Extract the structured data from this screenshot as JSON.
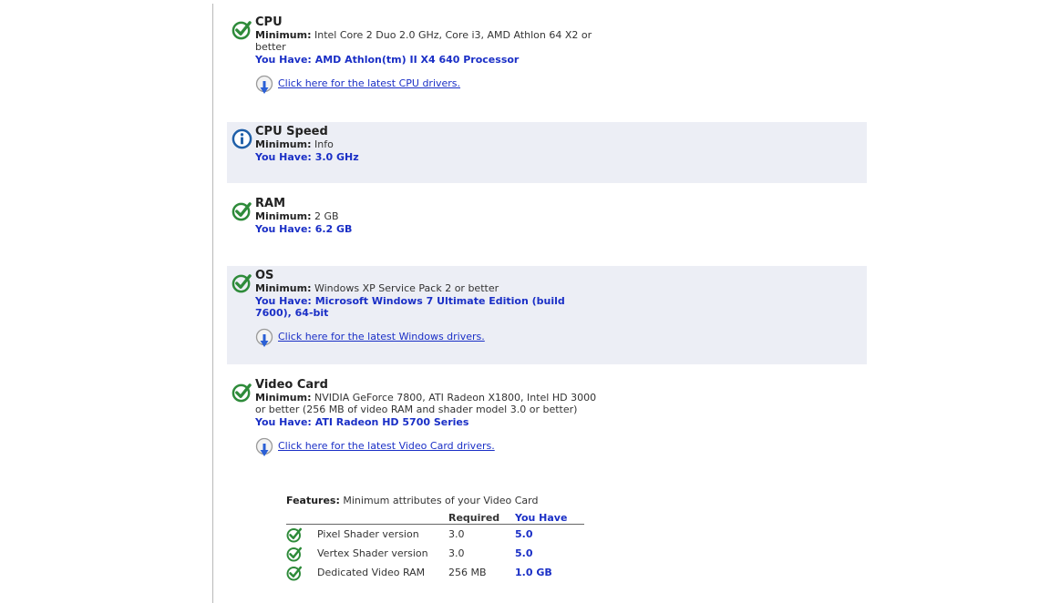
{
  "min_label": "Minimum:",
  "have_label": "You Have:",
  "sections": [
    {
      "title": "CPU",
      "status": "check-icon",
      "minimum": "Intel Core 2 Duo 2.0 GHz, Core i3, AMD Athlon 64 X2 or better",
      "have": "AMD Athlon(tm) II X4 640 Processor",
      "driver_link": "Click here for the latest CPU drivers."
    },
    {
      "title": "CPU Speed",
      "status": "info-icon",
      "minimum": "Info",
      "have": "3.0 GHz"
    },
    {
      "title": "RAM",
      "status": "check-icon",
      "minimum": "2 GB",
      "have": "6.2 GB"
    },
    {
      "title": "OS",
      "status": "check-icon",
      "minimum": "Windows XP Service Pack 2 or better",
      "have": "Microsoft Windows 7 Ultimate Edition (build 7600), 64-bit",
      "driver_link": "Click here for the latest Windows drivers."
    },
    {
      "title": "Video Card",
      "status": "check-icon",
      "minimum": "NVIDIA GeForce 7800, ATI Radeon X1800, Intel HD 3000 or better (256 MB of video RAM and shader model 3.0 or better)",
      "have": "ATI Radeon HD 5700 Series",
      "driver_link": "Click here for the latest Video Card drivers."
    }
  ],
  "features": {
    "label": "Features:",
    "description": "Minimum attributes of your Video Card",
    "col_required": "Required",
    "col_have": "You Have",
    "rows": [
      {
        "name": "Pixel Shader version",
        "required": "3.0",
        "have": "5.0"
      },
      {
        "name": "Vertex Shader version",
        "required": "3.0",
        "have": "5.0"
      },
      {
        "name": "Dedicated Video RAM",
        "required": "256 MB",
        "have": "1.0 GB"
      }
    ]
  },
  "colors": {
    "check": "#2e8b3a",
    "info": "#1f5fa8",
    "have_text": "#1a2fc6",
    "alt_bg": "#eceef5"
  }
}
